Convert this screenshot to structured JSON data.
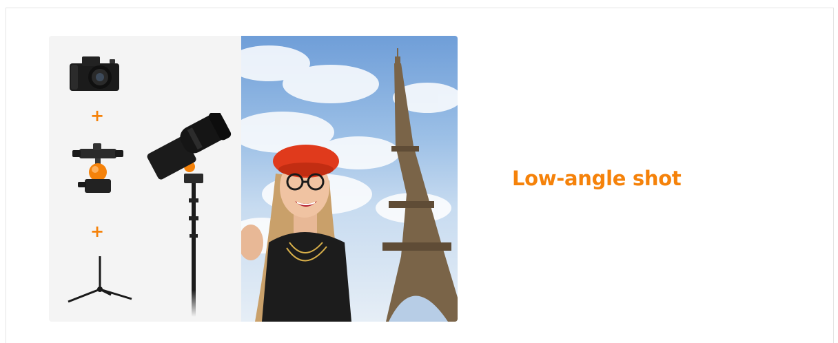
{
  "feature": {
    "caption": "Low-angle shot",
    "plus_sign": "+"
  },
  "icons": {
    "camera": "camera-icon",
    "ball_head": "ball-head-icon",
    "tripod": "tripod-icon",
    "plus": "plus-icon"
  },
  "colors": {
    "accent": "#f5820a",
    "panel_background": "#f4f4f4",
    "sky": "#7fa9dc"
  }
}
